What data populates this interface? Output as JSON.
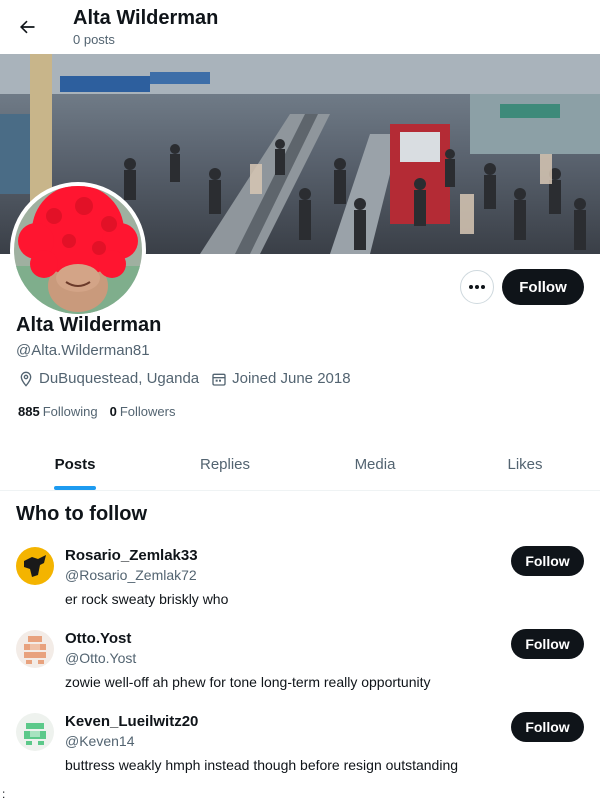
{
  "header": {
    "title": "Alta Wilderman",
    "subtitle": "0 posts",
    "back_icon": "arrow-left-icon"
  },
  "profile": {
    "display_name": "Alta Wilderman",
    "handle": "@Alta.Wilderman81",
    "location": "DuBuquestead, Uganda",
    "joined": "Joined June 2018",
    "following_count": "885",
    "following_label": "Following",
    "followers_count": "0",
    "followers_label": "Followers",
    "follow_label": "Follow",
    "more_icon": "ellipsis-icon"
  },
  "tabs": [
    {
      "label": "Posts",
      "active": true
    },
    {
      "label": "Replies",
      "active": false
    },
    {
      "label": "Media",
      "active": false
    },
    {
      "label": "Likes",
      "active": false
    }
  ],
  "who_to_follow": {
    "title": "Who to follow",
    "accounts": [
      {
        "name": "Rosario_Zemlak33",
        "handle": "@Rosario_Zemlak72",
        "bio": "er rock sweaty briskly who",
        "follow_label": "Follow"
      },
      {
        "name": "Otto.Yost",
        "handle": "@Otto.Yost",
        "bio": "zowie well-off ah phew for tone long-term really opportunity",
        "follow_label": "Follow"
      },
      {
        "name": "Keven_Lueilwitz20",
        "handle": "@Keven14",
        "bio": "buttress weakly hmph instead though before resign outstanding",
        "follow_label": "Follow"
      }
    ]
  },
  "footer_mark": ":",
  "colors": {
    "accent": "#1d9bf0",
    "button_dark": "#0f1419",
    "muted_text": "#536471"
  }
}
